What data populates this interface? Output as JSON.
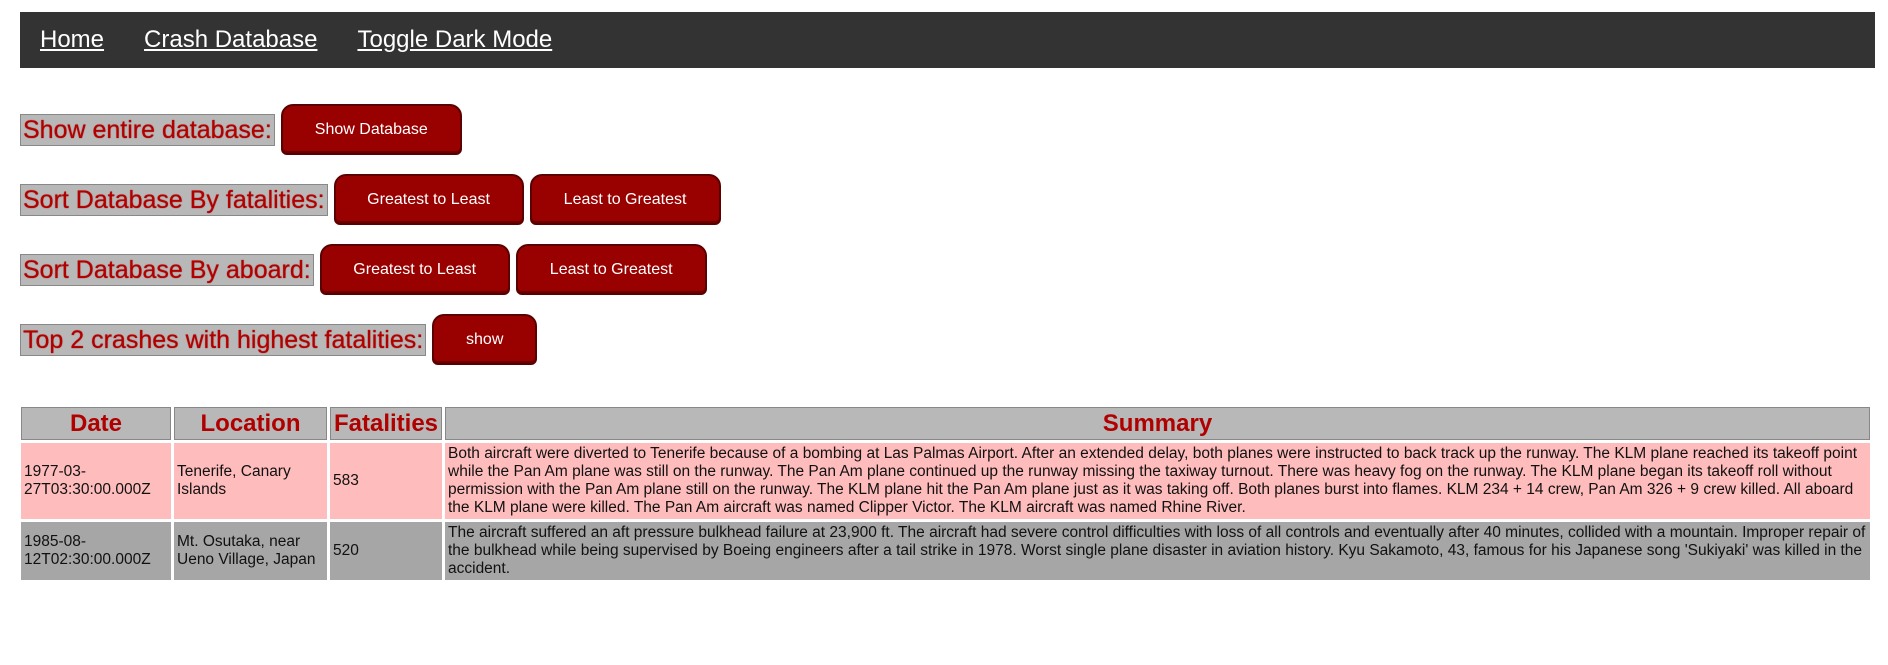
{
  "nav": {
    "home": "Home",
    "crash_database": "Crash Database",
    "toggle_dark_mode": "Toggle Dark Mode"
  },
  "controls": {
    "show_entire": {
      "label": "Show entire database:",
      "button": "Show Database"
    },
    "sort_fatalities": {
      "label": "Sort Database By fatalities:",
      "desc": "Greatest to Least",
      "asc": "Least to Greatest"
    },
    "sort_aboard": {
      "label": "Sort Database By aboard:",
      "desc": "Greatest to Least",
      "asc": "Least to Greatest"
    },
    "top2": {
      "label": "Top 2 crashes with highest fatalities:",
      "button": "show"
    }
  },
  "table": {
    "headers": [
      "Date",
      "Location",
      "Fatalities",
      "Summary"
    ],
    "rows": [
      {
        "date": "1977-03-27T03:30:00.000Z",
        "location": "Tenerife, Canary Islands",
        "fatalities": "583",
        "summary": "Both aircraft were diverted to Tenerife because of a bombing at Las Palmas Airport. After an extended delay, both planes were instructed to back track up the runway. The KLM plane reached its takeoff point while the Pan Am plane was still on the runway. The Pan Am plane continued up the runway missing the taxiway turnout. There was heavy fog on the runway. The KLM plane began its takeoff roll without permission with the Pan Am plane still on the runway. The KLM plane hit the Pan Am plane just as it was taking off. Both planes burst into flames. KLM 234 + 14 crew, Pan Am 326 + 9 crew killed. All aboard the KLM plane were killed. The Pan Am aircraft was named Clipper Victor. The KLM aircraft was named Rhine River."
      },
      {
        "date": "1985-08-12T02:30:00.000Z",
        "location": "Mt. Osutaka, near Ueno Village, Japan",
        "fatalities": "520",
        "summary": "The aircraft suffered an aft pressure bulkhead failure at 23,900 ft. The aircraft had severe control difficulties with loss of all controls and eventually after 40 minutes, collided with a mountain. Improper repair of the bulkhead while being supervised by Boeing engineers after a tail strike in 1978. Worst single plane disaster in aviation history. Kyu Sakamoto, 43, famous for his Japanese song 'Sukiyaki' was killed in the accident."
      }
    ]
  },
  "colors": {
    "nav_bg": "#333333",
    "button_bg": "#990000",
    "label_text": "#b00000",
    "label_bg": "#b8b8b8",
    "row_odd_bg": "#ffbcbc",
    "row_even_bg": "#a6a6a6"
  }
}
